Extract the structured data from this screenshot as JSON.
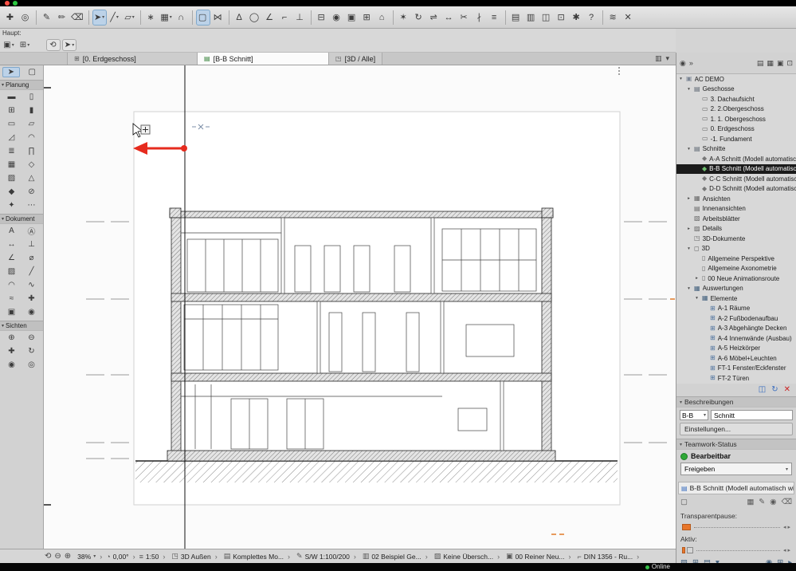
{
  "window": {
    "haupt_label": "Haupt:",
    "online_label": "Online"
  },
  "colors": {
    "accent_red": "#e62b1e",
    "status_green": "#2ea836",
    "slider_orange": "#e8762a",
    "selection_dark": "#1b1b1b",
    "tool_active_blue": "#bcd2e8"
  },
  "toolbar_main": {
    "items": [
      {
        "glyph": "✚"
      },
      {
        "glyph": "◎"
      },
      {
        "cls": "sep"
      },
      {
        "glyph": "✎"
      },
      {
        "glyph": "✏"
      },
      {
        "glyph": "⌫"
      },
      {
        "cls": "sep"
      },
      {
        "glyph": "➤",
        "caret": "▾",
        "cls": "active"
      },
      {
        "glyph": "╱",
        "caret": "▾"
      },
      {
        "glyph": "▱",
        "caret": "▾"
      },
      {
        "cls": "sep"
      },
      {
        "glyph": "∗"
      },
      {
        "glyph": "▦",
        "caret": "▾"
      },
      {
        "glyph": "∩"
      },
      {
        "cls": "sep"
      },
      {
        "glyph": "▢",
        "cls": "active"
      },
      {
        "glyph": "⋈"
      },
      {
        "cls": "sep"
      },
      {
        "glyph": "∆"
      },
      {
        "glyph": "◯"
      },
      {
        "glyph": "∠"
      },
      {
        "glyph": "⌐"
      },
      {
        "glyph": "⊥"
      },
      {
        "cls": "sep"
      },
      {
        "glyph": "⊟"
      },
      {
        "glyph": "◉"
      },
      {
        "glyph": "▣"
      },
      {
        "glyph": "⊞"
      },
      {
        "glyph": "⌂"
      },
      {
        "cls": "sep"
      },
      {
        "glyph": "✶"
      },
      {
        "glyph": "↻"
      },
      {
        "glyph": "⇌"
      },
      {
        "glyph": "↔"
      },
      {
        "glyph": "✂"
      },
      {
        "glyph": "∤"
      },
      {
        "glyph": "≡"
      },
      {
        "cls": "sep"
      },
      {
        "glyph": "▤"
      },
      {
        "glyph": "▥"
      },
      {
        "glyph": "◫"
      },
      {
        "glyph": "⊡"
      },
      {
        "glyph": "✱"
      },
      {
        "glyph": "?"
      },
      {
        "cls": "sep"
      },
      {
        "glyph": "≋"
      },
      {
        "glyph": "✕"
      }
    ]
  },
  "toolbar_secondary": {
    "items": [
      {
        "glyph": "▣",
        "caret": "▾"
      },
      {
        "glyph": "⊞",
        "caret": "▾"
      },
      {
        "glyph": "",
        "cls": "gap"
      },
      {
        "glyph": "⟲",
        "cls": "btn"
      },
      {
        "glyph": "➤",
        "caret": "▾",
        "cls": "btn"
      }
    ]
  },
  "tabbar": {
    "tabs": [
      {
        "icon": "⊞",
        "icolor": "#555555",
        "label": "[0. Erdgeschoss]"
      },
      {
        "icon": "▤",
        "icolor": "#2e7d32",
        "label": "[B-B Schnitt]",
        "cls": "active"
      },
      {
        "icon": "◳",
        "icolor": "#555555",
        "label": "[3D / Alle]"
      }
    ],
    "extra_icons": [
      {
        "glyph": "▥"
      },
      {
        "glyph": "▾"
      }
    ]
  },
  "left_palette": {
    "select_tools": [
      {
        "glyph": "➤",
        "cls": "active"
      },
      {
        "glyph": "▢"
      }
    ],
    "sections": [
      {
        "title": "Planung",
        "tools": [
          {
            "glyph": "▬"
          },
          {
            "glyph": "▯"
          },
          {
            "glyph": "⊞"
          },
          {
            "glyph": "▮"
          },
          {
            "glyph": "▭"
          },
          {
            "glyph": "▱"
          },
          {
            "glyph": "◿"
          },
          {
            "glyph": "◠"
          },
          {
            "glyph": "≣"
          },
          {
            "glyph": "∏"
          },
          {
            "glyph": "▦"
          },
          {
            "glyph": "◇"
          },
          {
            "glyph": "▨"
          },
          {
            "glyph": "△"
          },
          {
            "glyph": "◆"
          },
          {
            "glyph": "⊘"
          },
          {
            "glyph": "✦"
          },
          {
            "glyph": "⋯"
          }
        ]
      },
      {
        "title": "Dokument",
        "tools": [
          {
            "glyph": "A"
          },
          {
            "glyph": "Ⓐ"
          },
          {
            "glyph": "↔"
          },
          {
            "glyph": "⊥"
          },
          {
            "glyph": "∠"
          },
          {
            "glyph": "⌀"
          },
          {
            "glyph": "▨"
          },
          {
            "glyph": "╱"
          },
          {
            "glyph": "◠"
          },
          {
            "glyph": "∿"
          },
          {
            "glyph": "≈"
          },
          {
            "glyph": "✚"
          },
          {
            "glyph": "▣"
          },
          {
            "glyph": "◉"
          }
        ]
      },
      {
        "title": "Sichten",
        "tools": [
          {
            "glyph": "⊕"
          },
          {
            "glyph": "⊖"
          },
          {
            "glyph": "✚"
          },
          {
            "glyph": "↻"
          },
          {
            "glyph": "◉"
          },
          {
            "glyph": "◎"
          }
        ]
      }
    ]
  },
  "navigator": {
    "header_left": [
      {
        "glyph": "◉"
      },
      {
        "glyph": "»"
      }
    ],
    "header_right": [
      {
        "glyph": "▤"
      },
      {
        "glyph": "▦"
      },
      {
        "glyph": "▣"
      },
      {
        "glyph": "⊡"
      }
    ],
    "items": [
      {
        "pad": "2px",
        "arrow": "▾",
        "icon": "▣",
        "icolor": "#7d8796",
        "label": "AC DEMO"
      },
      {
        "pad": "12px",
        "arrow": "▾",
        "icon": "▤",
        "icolor": "#5a6470",
        "label": "Geschosse"
      },
      {
        "pad": "22px",
        "arrow": "",
        "icon": "▭",
        "icolor": "#666666",
        "label": "3. Dachaufsicht"
      },
      {
        "pad": "22px",
        "arrow": "",
        "icon": "▭",
        "icolor": "#666666",
        "label": "2. 2.Obergeschoss"
      },
      {
        "pad": "22px",
        "arrow": "",
        "icon": "▭",
        "icolor": "#666666",
        "label": "1. 1. Obergeschoss"
      },
      {
        "pad": "22px",
        "arrow": "",
        "icon": "▭",
        "icolor": "#666666",
        "label": "0. Erdgeschoss"
      },
      {
        "pad": "22px",
        "arrow": "",
        "icon": "▭",
        "icolor": "#666666",
        "label": "-1. Fundament"
      },
      {
        "pad": "12px",
        "arrow": "▾",
        "icon": "▤",
        "icolor": "#5a6470",
        "label": "Schnitte"
      },
      {
        "pad": "22px",
        "arrow": "",
        "icon": "◆",
        "icolor": "#777777",
        "label": "A-A Schnitt (Modell automatisch wi..."
      },
      {
        "pad": "22px",
        "arrow": "",
        "icon": "◆",
        "icolor": "#6fbf6f",
        "label": "B-B Schnitt (Modell automatisch wi...",
        "cls": "selected"
      },
      {
        "pad": "22px",
        "arrow": "",
        "icon": "◆",
        "icolor": "#777777",
        "label": "C-C Schnitt (Modell automatisch wi..."
      },
      {
        "pad": "22px",
        "arrow": "",
        "icon": "◆",
        "icolor": "#777777",
        "label": "D-D Schnitt (Modell automatisch wie..."
      },
      {
        "pad": "12px",
        "arrow": "▸",
        "icon": "▦",
        "icolor": "#666666",
        "label": "Ansichten"
      },
      {
        "pad": "12px",
        "arrow": "",
        "icon": "▤",
        "icolor": "#666666",
        "label": "Innenansichten"
      },
      {
        "pad": "12px",
        "arrow": "",
        "icon": "▧",
        "icolor": "#666666",
        "label": "Arbeitsblätter"
      },
      {
        "pad": "12px",
        "arrow": "▸",
        "icon": "▨",
        "icolor": "#666666",
        "label": "Details"
      },
      {
        "pad": "12px",
        "arrow": "",
        "icon": "◳",
        "icolor": "#666666",
        "label": "3D-Dokumente"
      },
      {
        "pad": "12px",
        "arrow": "▾",
        "icon": "◻",
        "icolor": "#666666",
        "label": "3D"
      },
      {
        "pad": "22px",
        "arrow": "",
        "icon": "▯",
        "icolor": "#666666",
        "label": "Allgemeine Perspektive"
      },
      {
        "pad": "22px",
        "arrow": "",
        "icon": "▯",
        "icolor": "#666666",
        "label": "Allgemeine Axonometrie"
      },
      {
        "pad": "22px",
        "arrow": "▸",
        "icon": "▯",
        "icolor": "#666666",
        "label": "00 Neue Animationsroute"
      },
      {
        "pad": "12px",
        "arrow": "▾",
        "icon": "▦",
        "icolor": "#44617e",
        "label": "Auswertungen"
      },
      {
        "pad": "22px",
        "arrow": "▾",
        "icon": "▦",
        "icolor": "#44617e",
        "label": "Elemente"
      },
      {
        "pad": "32px",
        "arrow": "",
        "icon": "⊞",
        "icolor": "#4a6f9c",
        "label": "A-1 Räume"
      },
      {
        "pad": "32px",
        "arrow": "",
        "icon": "⊞",
        "icolor": "#4a6f9c",
        "label": "A-2 Fußbodenaufbau"
      },
      {
        "pad": "32px",
        "arrow": "",
        "icon": "⊞",
        "icolor": "#4a6f9c",
        "label": "A-3 Abgehängte Decken"
      },
      {
        "pad": "32px",
        "arrow": "",
        "icon": "⊞",
        "icolor": "#4a6f9c",
        "label": "A-4 Innenwände (Ausbau)"
      },
      {
        "pad": "32px",
        "arrow": "",
        "icon": "⊞",
        "icolor": "#4a6f9c",
        "label": "A-5 Heizkörper"
      },
      {
        "pad": "32px",
        "arrow": "",
        "icon": "⊞",
        "icolor": "#4a6f9c",
        "label": "A-6 Möbel+Leuchten"
      },
      {
        "pad": "32px",
        "arrow": "",
        "icon": "⊞",
        "icolor": "#4a6f9c",
        "label": "FT-1 Fenster/Eckfenster"
      },
      {
        "pad": "32px",
        "arrow": "",
        "icon": "⊞",
        "icolor": "#4a6f9c",
        "label": "FT-2 Türen"
      }
    ],
    "action_icons": [
      {
        "glyph": "◫",
        "color": "#3a6ebf"
      },
      {
        "glyph": "↻",
        "color": "#3a6ebf"
      },
      {
        "glyph": "✕",
        "color": "#cc2222"
      }
    ]
  },
  "right_panel": {
    "beschreibungen": {
      "title": "Beschreibungen",
      "id_value": "B-B",
      "name_value": "Schnitt",
      "settings_label": "Einstellungen..."
    },
    "teamwork": {
      "title": "Teamwork-Status",
      "status": "Bearbeitbar",
      "action": "Freigeben"
    },
    "view_info": "B-B Schnitt (Modell automatisch wie...",
    "view_info_icon": "▤",
    "tool_icons_row": [
      {
        "glyph": "▢"
      },
      {
        "glyph": "▦",
        "cls": "push"
      },
      {
        "glyph": "✎"
      },
      {
        "glyph": "◉"
      },
      {
        "glyph": "⌫"
      }
    ],
    "transparentpause_label": "Transparentpause:",
    "aktiv_label": "Aktiv:",
    "bottom_icons_left": [
      {
        "glyph": "▧"
      },
      {
        "glyph": "⊞"
      },
      {
        "glyph": "▤"
      },
      {
        "glyph": "▾"
      }
    ],
    "bottom_icons_right": [
      {
        "glyph": "◉"
      },
      {
        "glyph": "⊞"
      },
      {
        "glyph": "▸"
      }
    ]
  },
  "statusbar": {
    "nav_icons": [
      {
        "glyph": "⟲"
      },
      {
        "glyph": "⊖"
      },
      {
        "glyph": "⊕"
      }
    ],
    "zoom_value": "38%",
    "rotation_icon": "◔",
    "rotation_value": "0,00°",
    "scale_icon": "≡",
    "scale_value": "1:50",
    "items": [
      {
        "icon": "◳",
        "label": "3D Außen"
      },
      {
        "icon": "▤",
        "label": "Komplettes Mo..."
      },
      {
        "icon": "✎",
        "label": "S/W 1:100/200"
      },
      {
        "icon": "▥",
        "label": "02 Beispiel Ge..."
      },
      {
        "icon": "▨",
        "label": "Keine Übersch..."
      },
      {
        "icon": "▣",
        "label": "00 Reiner Neu..."
      },
      {
        "icon": "⌐",
        "label": "DIN 1356 - Ru..."
      }
    ]
  }
}
